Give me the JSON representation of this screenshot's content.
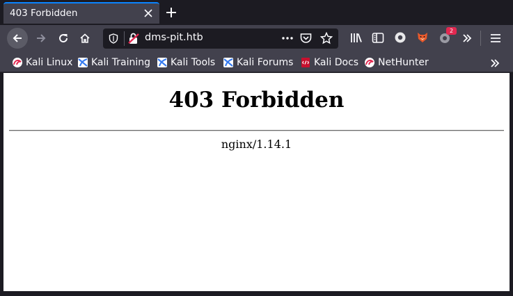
{
  "tab": {
    "title": "403 Forbidden"
  },
  "urlbar": {
    "url": "dms-pit.htb"
  },
  "toolbar": {
    "notification_count": "2"
  },
  "bookmarks": [
    {
      "label": "Kali Linux"
    },
    {
      "label": "Kali Training"
    },
    {
      "label": "Kali Tools"
    },
    {
      "label": "Kali Forums"
    },
    {
      "label": "Kali Docs"
    },
    {
      "label": "NetHunter"
    }
  ],
  "page": {
    "heading": "403 Forbidden",
    "server": "nginx/1.14.1"
  },
  "colors": {
    "accent": "#0a84ff",
    "toolbar": "#42414d",
    "frame": "#1c1b22",
    "badge": "#e22850"
  }
}
